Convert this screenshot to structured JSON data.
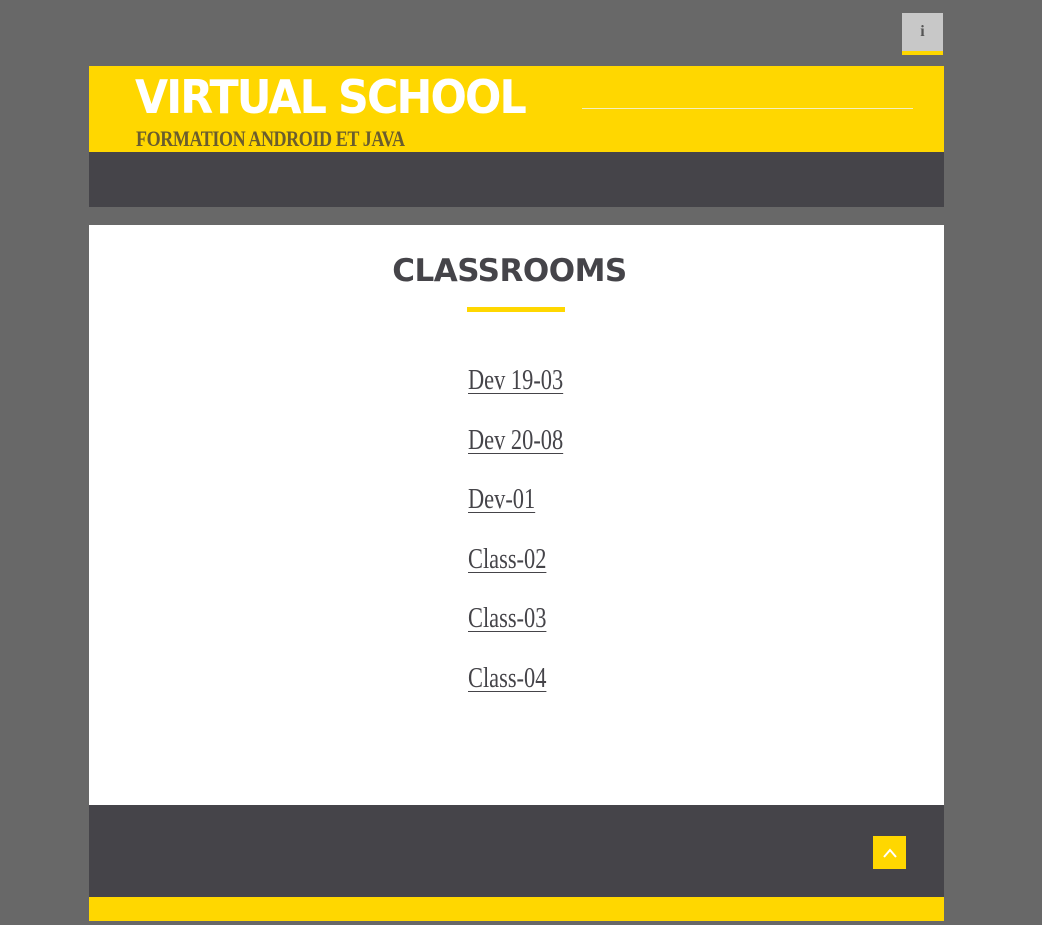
{
  "topbar": {
    "info_label": "i"
  },
  "header": {
    "title": "VIRTUAL SCHOOL",
    "subtitle": "FORMATION ANDROID ET JAVA"
  },
  "main": {
    "heading": "CLASSROOMS",
    "classrooms": [
      {
        "label": "Dev 19-03"
      },
      {
        "label": "Dev 20-08"
      },
      {
        "label": "Dev-01"
      },
      {
        "label": "Class-02"
      },
      {
        "label": "Class-03"
      },
      {
        "label": "Class-04"
      }
    ]
  },
  "footer": {
    "scroll_top_icon": "chevron-up-icon"
  },
  "colors": {
    "accent": "#ffd700",
    "dark": "#454449",
    "background": "#686868",
    "content_bg": "#ffffff"
  }
}
